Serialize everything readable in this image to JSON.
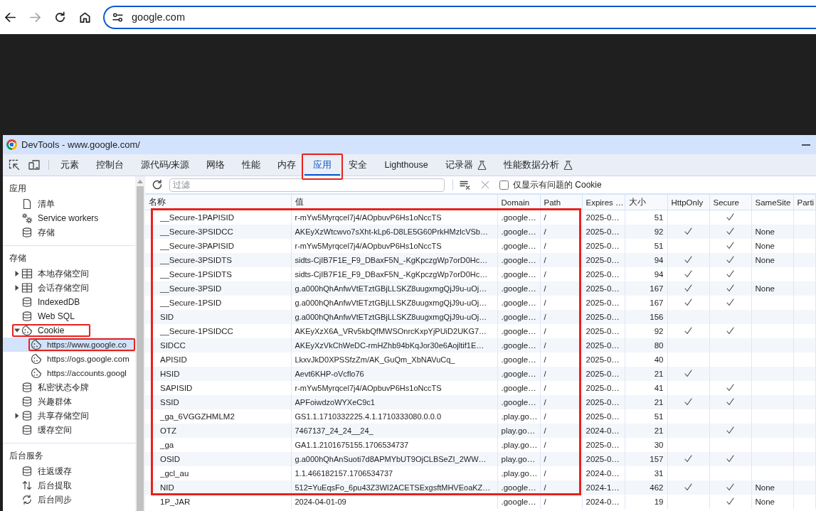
{
  "browser": {
    "nav_buttons": [
      {
        "kind": "back",
        "disabled": false
      },
      {
        "kind": "forward",
        "disabled": true
      },
      {
        "kind": "reload",
        "disabled": false
      },
      {
        "kind": "home",
        "disabled": false
      }
    ],
    "address": "google.com"
  },
  "devtools": {
    "title": "DevTools - www.google.com/",
    "tabs": [
      {
        "label": "元素",
        "selected": false,
        "experimental": false,
        "highlighted": false
      },
      {
        "label": "控制台",
        "selected": false,
        "experimental": false,
        "highlighted": false
      },
      {
        "label": "源代码/来源",
        "selected": false,
        "experimental": false,
        "highlighted": false
      },
      {
        "label": "网络",
        "selected": false,
        "experimental": false,
        "highlighted": false
      },
      {
        "label": "性能",
        "selected": false,
        "experimental": false,
        "highlighted": false
      },
      {
        "label": "内存",
        "selected": false,
        "experimental": false,
        "highlighted": false
      },
      {
        "label": "应用",
        "selected": true,
        "experimental": false,
        "highlighted": true
      },
      {
        "label": "安全",
        "selected": false,
        "experimental": false,
        "highlighted": false
      },
      {
        "label": "Lighthouse",
        "selected": false,
        "experimental": false,
        "highlighted": false
      },
      {
        "label": "记录器",
        "selected": false,
        "experimental": true,
        "highlighted": false
      },
      {
        "label": "性能数据分析",
        "selected": false,
        "experimental": true,
        "highlighted": false
      }
    ],
    "sidebar": {
      "sections": [
        {
          "title": "应用",
          "items": [
            {
              "label": "清单",
              "kind": "document",
              "selected": false,
              "highlighted": false
            },
            {
              "label": "Service workers",
              "kind": "gears",
              "selected": false,
              "highlighted": false
            },
            {
              "label": "存储",
              "kind": "database",
              "selected": false,
              "highlighted": false
            }
          ]
        },
        {
          "title": "存储",
          "items": [
            {
              "label": "本地存储空间",
              "kind": "grid",
              "selected": false,
              "highlighted": false,
              "expanded": false
            },
            {
              "label": "会话存储空间",
              "kind": "grid",
              "selected": false,
              "highlighted": false,
              "expanded": false
            },
            {
              "label": "IndexedDB",
              "kind": "database",
              "selected": false,
              "highlighted": false
            },
            {
              "label": "Web SQL",
              "kind": "database",
              "selected": false,
              "highlighted": false
            },
            {
              "label": "Cookie",
              "kind": "cookie",
              "selected": false,
              "highlighted": true,
              "expanded": true,
              "children": [
                {
                  "label": "https://www.google.co",
                  "kind": "cookie",
                  "selected": true,
                  "highlighted": true
                },
                {
                  "label": "https://ogs.google.com",
                  "kind": "cookie",
                  "selected": false,
                  "highlighted": false
                },
                {
                  "label": "https://accounts.googl",
                  "kind": "cookie",
                  "selected": false,
                  "highlighted": false
                }
              ]
            },
            {
              "label": "私密状态令牌",
              "kind": "database",
              "selected": false,
              "highlighted": false
            },
            {
              "label": "兴趣群体",
              "kind": "database",
              "selected": false,
              "highlighted": false
            },
            {
              "label": "共享存储空间",
              "kind": "database",
              "selected": false,
              "highlighted": false,
              "expanded": false
            },
            {
              "label": "缓存空间",
              "kind": "database",
              "selected": false,
              "highlighted": false
            }
          ]
        },
        {
          "title": "后台服务",
          "items": [
            {
              "label": "往返缓存",
              "kind": "database",
              "selected": false,
              "highlighted": false
            },
            {
              "label": "后台提取",
              "kind": "transfer",
              "selected": false,
              "highlighted": false
            },
            {
              "label": "后台同步",
              "kind": "sync",
              "selected": false,
              "highlighted": false
            }
          ]
        }
      ]
    },
    "toolbar": {
      "filter": {
        "placeholder": "过滤"
      },
      "delete_disabled": true,
      "issues_only": {
        "label": "仅显示有问题的 Cookie",
        "checked": false
      }
    },
    "table": {
      "highlighted": true,
      "columns": [
        "名称",
        "值",
        "Domain",
        "Path",
        "Expires …",
        "大小",
        "HttpOnly",
        "Secure",
        "SameSite",
        "Parti"
      ],
      "rows": [
        {
          "name": "__Secure-1PAPISID",
          "value": "r-mYw5Myrqcel7j4/AOpbuvP6Hs1oNccTS",
          "domain": ".google…",
          "path": "/",
          "expires": "2025-0…",
          "size": "51",
          "http_only": false,
          "secure": true
        },
        {
          "name": "__Secure-3PSIDCC",
          "value": "AKEyXzWtcwvo7sXht-kLp6-D8LE5G60PrkHMzlcVSb…",
          "domain": ".google…",
          "path": "/",
          "expires": "2025-0…",
          "size": "92",
          "http_only": true,
          "secure": true,
          "same_site": "None"
        },
        {
          "name": "__Secure-3PAPISID",
          "value": "r-mYw5Myrqcel7j4/AOpbuvP6Hs1oNccTS",
          "domain": ".google…",
          "path": "/",
          "expires": "2025-0…",
          "size": "51",
          "http_only": false,
          "secure": true,
          "same_site": "None"
        },
        {
          "name": "__Secure-3PSIDTS",
          "value": "sidts-CjIB7F1E_F9_DBaxF5N_-KgKpczgWp7orD0Hc…",
          "domain": ".google…",
          "path": "/",
          "expires": "2025-0…",
          "size": "94",
          "http_only": true,
          "secure": true,
          "same_site": "None"
        },
        {
          "name": "__Secure-1PSIDTS",
          "value": "sidts-CjIB7F1E_F9_DBaxF5N_-KgKpczgWp7orD0Hc…",
          "domain": ".google…",
          "path": "/",
          "expires": "2025-0…",
          "size": "94",
          "http_only": true,
          "secure": true
        },
        {
          "name": "__Secure-3PSID",
          "value": "g.a000hQhAnfwVtETztGBjLLSKZ8uugxmgQjJ9u-uOj…",
          "domain": ".google…",
          "path": "/",
          "expires": "2025-0…",
          "size": "167",
          "http_only": true,
          "secure": true,
          "same_site": "None"
        },
        {
          "name": "__Secure-1PSID",
          "value": "g.a000hQhAnfwVtETztGBjLLSKZ8uugxmgQjJ9u-uOj…",
          "domain": ".google…",
          "path": "/",
          "expires": "2025-0…",
          "size": "167",
          "http_only": true,
          "secure": true
        },
        {
          "name": "SID",
          "value": "g.a000hQhAnfwVtETztGBjLLSKZ8uugxmgQjJ9u-uOj…",
          "domain": ".google…",
          "path": "/",
          "expires": "2025-0…",
          "size": "156",
          "http_only": false,
          "secure": false
        },
        {
          "name": "__Secure-1PSIDCC",
          "value": "AKEyXzX6A_VRv5kbQfMWSOnrcKxpYjPUiD2UKG7…",
          "domain": ".google…",
          "path": "/",
          "expires": "2025-0…",
          "size": "92",
          "http_only": true,
          "secure": true
        },
        {
          "name": "SIDCC",
          "value": "AKEyXzVkChWeDC-rmHZhb94bKqJor30e6Aojltif1E…",
          "domain": ".google…",
          "path": "/",
          "expires": "2025-0…",
          "size": "80",
          "http_only": false,
          "secure": false
        },
        {
          "name": "APISID",
          "value": "LkxvJkD0XPSSfzZm/AK_GuQm_XbNAVuCq_",
          "domain": ".google…",
          "path": "/",
          "expires": "2025-0…",
          "size": "40",
          "http_only": false,
          "secure": false
        },
        {
          "name": "HSID",
          "value": "Aevt6KHP-oVcflo76",
          "domain": ".google…",
          "path": "/",
          "expires": "2025-0…",
          "size": "21",
          "http_only": true,
          "secure": false
        },
        {
          "name": "SAPISID",
          "value": "r-mYw5Myrqcel7j4/AOpbuvP6Hs1oNccTS",
          "domain": ".google…",
          "path": "/",
          "expires": "2025-0…",
          "size": "41",
          "http_only": false,
          "secure": true
        },
        {
          "name": "SSID",
          "value": "APFoiwdzoWYXeC9c1",
          "domain": ".google…",
          "path": "/",
          "expires": "2025-0…",
          "size": "21",
          "http_only": true,
          "secure": true
        },
        {
          "name": "_ga_6VGGZHMLM2",
          "value": "GS1.1.1710332225.4.1.1710333080.0.0.0",
          "domain": ".play.go…",
          "path": "/",
          "expires": "2025-0…",
          "size": "51",
          "http_only": false,
          "secure": false
        },
        {
          "name": "OTZ",
          "value": "7467137_24_24__24_",
          "domain": "play.go…",
          "path": "/",
          "expires": "2024-0…",
          "size": "21",
          "http_only": false,
          "secure": true
        },
        {
          "name": "_ga",
          "value": "GA1.1.2101675155.1706534737",
          "domain": ".play.go…",
          "path": "/",
          "expires": "2025-0…",
          "size": "30",
          "http_only": false,
          "secure": false
        },
        {
          "name": "OSID",
          "value": "g.a000hQhAnSuoti7d8APMYbUT9OjCLBSeZI_2WW…",
          "domain": "play.go…",
          "path": "/",
          "expires": "2025-0…",
          "size": "157",
          "http_only": true,
          "secure": true
        },
        {
          "name": "_gcl_au",
          "value": "1.1.466182157.1706534737",
          "domain": ".play.go…",
          "path": "/",
          "expires": "2024-0…",
          "size": "31",
          "http_only": false,
          "secure": false
        },
        {
          "name": "NID",
          "value": "512=YuEqsFo_6pu43Z3WI2ACETSExgsftMHVEoaKZ…",
          "domain": ".google…",
          "path": "/",
          "expires": "2024-1…",
          "size": "462",
          "http_only": true,
          "secure": true,
          "same_site": "None"
        },
        {
          "name": "1P_JAR",
          "value": "2024-04-01-09",
          "domain": ".google…",
          "path": "/",
          "expires": "2024-0…",
          "size": "19",
          "http_only": false,
          "secure": true,
          "same_site": "None"
        }
      ]
    }
  }
}
